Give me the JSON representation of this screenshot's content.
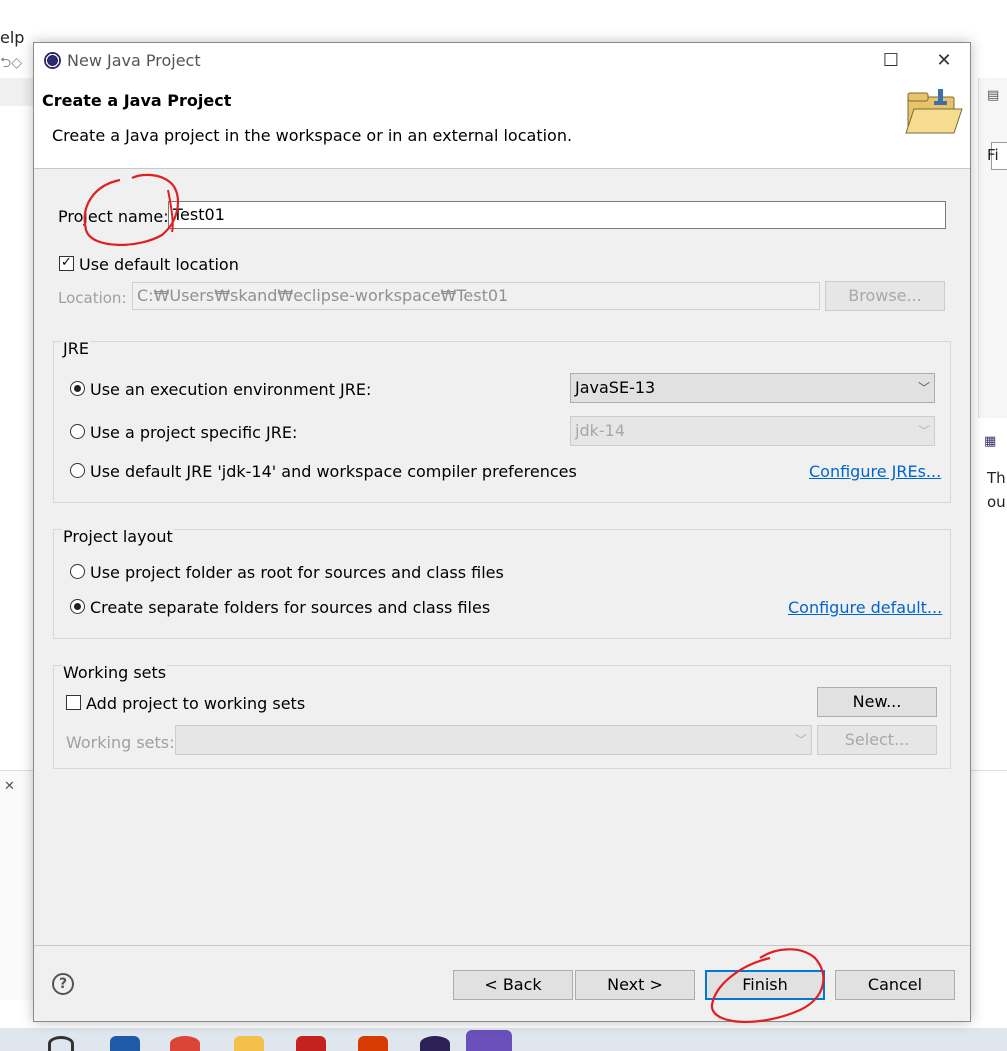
{
  "background": {
    "menu_fragment": "elp",
    "right_fragment_1": "Fi",
    "right_fragment_2": "Th",
    "right_fragment_3": "ou"
  },
  "dialog": {
    "window_title": "New Java Project",
    "header_title": "Create a Java Project",
    "header_description": "Create a Java project in the workspace or in an external location.",
    "project_name_label": "Project name:",
    "project_name_value": "Test01",
    "use_default_location_label": "Use default location",
    "use_default_location_checked": true,
    "location_label": "Location:",
    "location_value": "C:₩Users₩skand₩eclipse-workspace₩Test01",
    "browse_label": "Browse...",
    "jre": {
      "group_title": "JRE",
      "option_env_label": "Use an execution environment JRE:",
      "option_env_value": "JavaSE-13",
      "option_specific_label": "Use a project specific JRE:",
      "option_specific_value": "jdk-14",
      "option_default_label": "Use default JRE 'jdk-14' and workspace compiler preferences",
      "configure_link": "Configure JREs...",
      "selected": "option_env"
    },
    "layout": {
      "group_title": "Project layout",
      "option_root_label": "Use project folder as root for sources and class files",
      "option_separate_label": "Create separate folders for sources and class files",
      "configure_link": "Configure default...",
      "selected": "option_separate"
    },
    "working_sets": {
      "group_title": "Working sets",
      "add_label": "Add project to working sets",
      "add_checked": false,
      "new_label": "New...",
      "sets_label": "Working sets:",
      "select_label": "Select..."
    },
    "buttons": {
      "help": "?",
      "back": "< Back",
      "next": "Next >",
      "finish": "Finish",
      "cancel": "Cancel"
    },
    "colors": {
      "dialog_bg": "#f0f0f0",
      "link": "#0066cc",
      "focus_border": "#0078d7",
      "annotation": "#e02020"
    }
  }
}
